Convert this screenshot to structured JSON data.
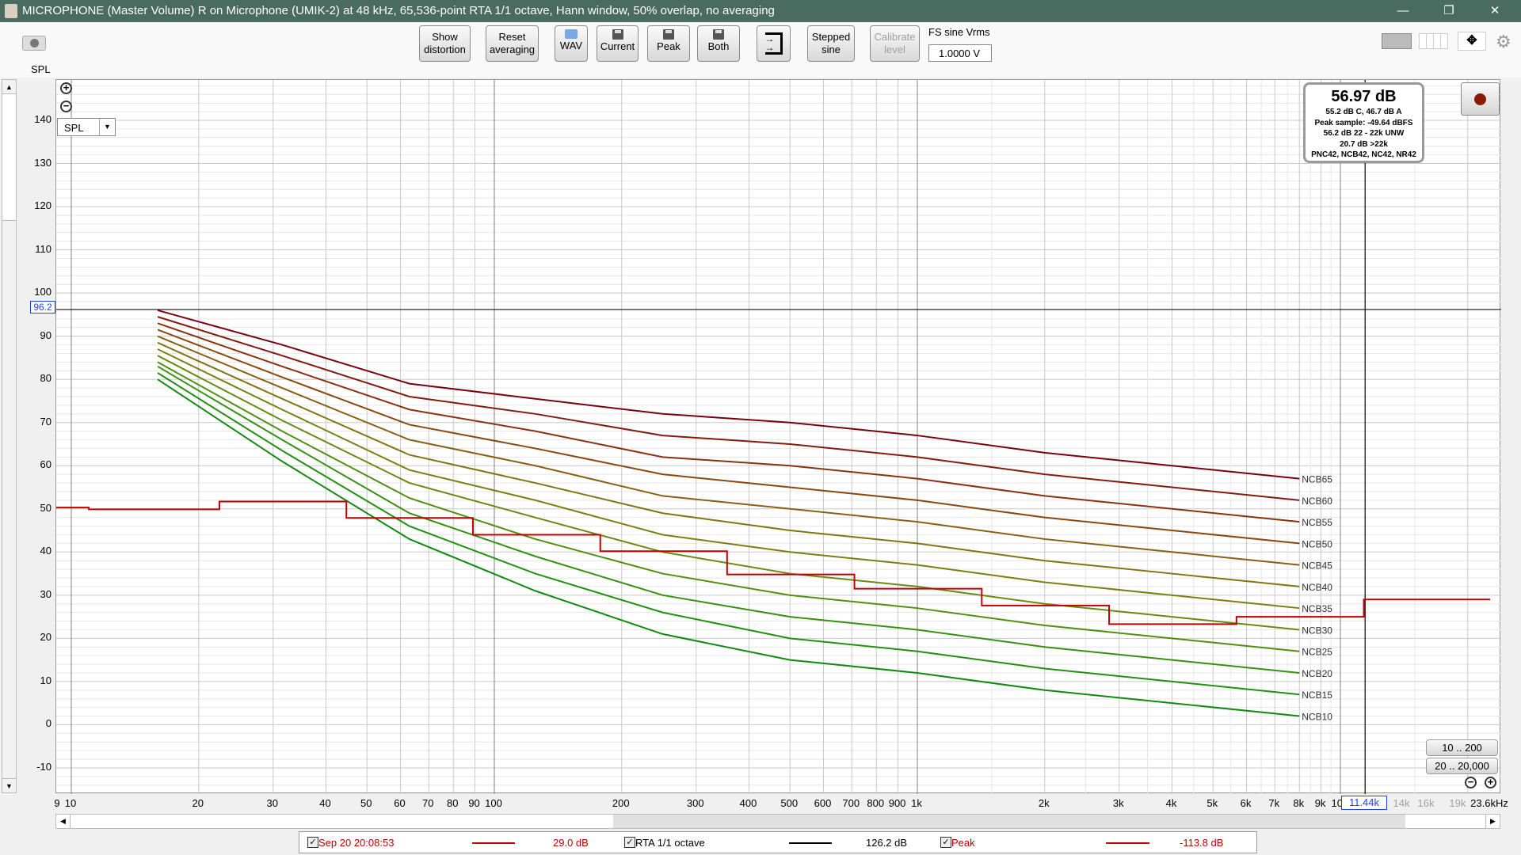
{
  "window": {
    "title": "MICROPHONE (Master Volume) R on Microphone (UMIK-2) at 48 kHz, 65,536-point RTA 1/1 octave, Hann window, 50% overlap, no averaging",
    "minimize": "—",
    "restore": "❐",
    "close": "✕"
  },
  "toolbar": {
    "show_distortion": [
      "Show",
      "distortion"
    ],
    "reset_averaging": [
      "Reset",
      "averaging"
    ],
    "wav": "WAV",
    "current": "Current",
    "peak": "Peak",
    "both": "Both",
    "stepped_sine": [
      "Stepped",
      "sine"
    ],
    "calibrate_level": [
      "Calibrate",
      "level"
    ],
    "fs_sine_label": "FS sine Vrms",
    "fs_sine_value": "1.0000 V"
  },
  "plot": {
    "y_label": "SPL",
    "y_select": "SPL",
    "cursor_y_value": "96.2",
    "cursor_x_value": "11.44k",
    "range_buttons": [
      "10 .. 200",
      "20 .. 20,000"
    ]
  },
  "readout": {
    "main": "56.97 dB",
    "lines": [
      "55.2 dB C, 46.7 dB A",
      "Peak sample: -49.64 dBFS",
      "56.2 dB 22 - 22k UNW",
      "20.7 dB >22k",
      "PNC42, NCB42, NC42, NR42"
    ]
  },
  "legend": [
    {
      "checked": true,
      "name": "Sep 20 20:08:53",
      "value": "29.0 dB",
      "color": "#c00000"
    },
    {
      "checked": true,
      "name": "RTA 1/1 octave",
      "value": "126.2 dB",
      "color": "#000000"
    },
    {
      "checked": true,
      "name": "Peak",
      "value": "-113.8 dB",
      "color": "#c00000"
    }
  ],
  "chart_data": {
    "type": "line",
    "title": "",
    "xlabel": "Hz",
    "ylabel": "SPL",
    "xscale": "log",
    "xlim": [
      9.2,
      23600
    ],
    "ylim": [
      -16,
      149
    ],
    "yticks": [
      "140",
      "130",
      "120",
      "110",
      "100",
      "90",
      "80",
      "70",
      "60",
      "50",
      "40",
      "30",
      "20",
      "10",
      "0",
      "-10"
    ],
    "xticks": [
      {
        "f": 9,
        "label": "9"
      },
      {
        "f": 10,
        "label": "10"
      },
      {
        "f": 20,
        "label": "20"
      },
      {
        "f": 30,
        "label": "30"
      },
      {
        "f": 40,
        "label": "40"
      },
      {
        "f": 50,
        "label": "50"
      },
      {
        "f": 60,
        "label": "60"
      },
      {
        "f": 70,
        "label": "70"
      },
      {
        "f": 80,
        "label": "80"
      },
      {
        "f": 90,
        "label": "90"
      },
      {
        "f": 100,
        "label": "100"
      },
      {
        "f": 200,
        "label": "200"
      },
      {
        "f": 300,
        "label": "300"
      },
      {
        "f": 400,
        "label": "400"
      },
      {
        "f": 500,
        "label": "500"
      },
      {
        "f": 600,
        "label": "600"
      },
      {
        "f": 700,
        "label": "700"
      },
      {
        "f": 800,
        "label": "800"
      },
      {
        "f": 900,
        "label": "900"
      },
      {
        "f": 1000,
        "label": "1k"
      },
      {
        "f": 2000,
        "label": "2k"
      },
      {
        "f": 3000,
        "label": "3k"
      },
      {
        "f": 4000,
        "label": "4k"
      },
      {
        "f": 5000,
        "label": "5k"
      },
      {
        "f": 6000,
        "label": "6k"
      },
      {
        "f": 7000,
        "label": "7k"
      },
      {
        "f": 8000,
        "label": "8k"
      },
      {
        "f": 9000,
        "label": "9k"
      },
      {
        "f": 10000,
        "label": "10k"
      },
      {
        "f": 14000,
        "label": "14k",
        "muted": true
      },
      {
        "f": 16000,
        "label": "16k",
        "muted": true
      },
      {
        "f": 19000,
        "label": "19k",
        "muted": true
      },
      {
        "f": 23600,
        "label": "23.6kHz"
      }
    ],
    "ncb_freqs": [
      16,
      31.5,
      63,
      125,
      250,
      500,
      1000,
      2000,
      4000,
      8000
    ],
    "ncb_curves": [
      {
        "name": "NCB65",
        "color": "#7a0010",
        "values": [
          96,
          88,
          79,
          75.5,
          72,
          70,
          67,
          63,
          60,
          57
        ]
      },
      {
        "name": "NCB60",
        "color": "#841a10",
        "values": [
          94.5,
          85.5,
          76,
          72,
          67,
          65,
          62,
          58,
          55,
          52
        ]
      },
      {
        "name": "NCB55",
        "color": "#8a3210",
        "values": [
          93,
          83,
          73,
          68,
          62,
          60,
          57,
          53,
          50,
          47
        ]
      },
      {
        "name": "NCB50",
        "color": "#8a4810",
        "values": [
          91.5,
          80.5,
          69.5,
          64,
          58,
          55,
          52,
          48,
          45,
          42
        ]
      },
      {
        "name": "NCB45",
        "color": "#886010",
        "values": [
          90,
          78,
          66,
          60,
          53,
          50,
          47,
          43,
          40,
          37
        ]
      },
      {
        "name": "NCB40",
        "color": "#827410",
        "values": [
          88.5,
          75.5,
          62.5,
          56,
          49,
          45,
          42,
          38,
          35,
          32
        ]
      },
      {
        "name": "NCB35",
        "color": "#7a8010",
        "values": [
          87,
          73,
          59,
          52,
          44,
          40,
          37,
          33,
          30,
          27
        ]
      },
      {
        "name": "NCB30",
        "color": "#688a10",
        "values": [
          85.5,
          70.5,
          56,
          48,
          40,
          35,
          32,
          28,
          25,
          22
        ]
      },
      {
        "name": "NCB25",
        "color": "#509010",
        "values": [
          84,
          68,
          52.5,
          43,
          35,
          30,
          27,
          23,
          20,
          17
        ]
      },
      {
        "name": "NCB20",
        "color": "#389010",
        "values": [
          83,
          66,
          49,
          39,
          30,
          25,
          22,
          18,
          15,
          12
        ]
      },
      {
        "name": "NCB15",
        "color": "#229010",
        "values": [
          81.5,
          63.5,
          46,
          35,
          26,
          20,
          17,
          13,
          10,
          7
        ]
      },
      {
        "name": "NCB10",
        "color": "#108a10",
        "values": [
          80,
          61,
          43,
          31,
          21,
          15,
          12,
          8,
          5,
          2
        ]
      }
    ],
    "measurement": {
      "name": "Sep 20 20:08:53",
      "color": "#c00000",
      "band_edges": [
        9.2,
        11,
        22.4,
        44.7,
        89,
        178,
        355,
        710,
        1420,
        2840,
        5680,
        11360,
        22600
      ],
      "levels": [
        50.3,
        49.9,
        51.7,
        47.9,
        44.0,
        40.2,
        34.8,
        31.5,
        27.6,
        23.3,
        25.0,
        29.0
      ]
    }
  }
}
